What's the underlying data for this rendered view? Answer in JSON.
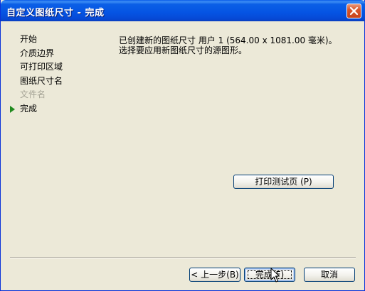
{
  "window": {
    "title": "自定义图纸尺寸 - 完成"
  },
  "sidebar": {
    "items": [
      {
        "label": "开始",
        "state": "normal"
      },
      {
        "label": "介质边界",
        "state": "normal"
      },
      {
        "label": "可打印区域",
        "state": "normal"
      },
      {
        "label": "图纸尺寸名",
        "state": "normal"
      },
      {
        "label": "文件名",
        "state": "disabled"
      },
      {
        "label": "完成",
        "state": "current"
      }
    ]
  },
  "content": {
    "line1": "已创建新的图纸尺寸 用户 1 (564.00 x 1081.00 毫米)。",
    "line2": "选择要应用新图纸尺寸的源图形。"
  },
  "buttons": {
    "print_test": "打印测试页 (P)",
    "back": "< 上一步(B)",
    "finish": "完成(F)",
    "cancel": "取消"
  },
  "colors": {
    "title_bar": "#0554e3",
    "close_button": "#d9552b",
    "current_step_arrow": "#218a1f"
  }
}
